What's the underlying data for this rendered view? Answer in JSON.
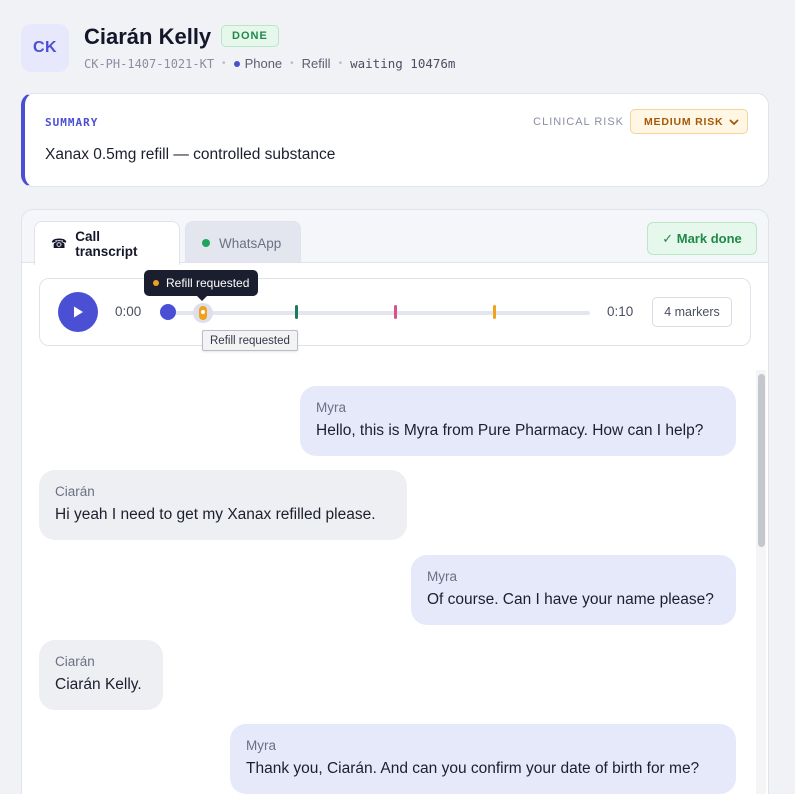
{
  "contact": {
    "initials": "CK",
    "name": "Ciarán Kelly",
    "status": "DONE",
    "id": "CK-PH-1407-1021-KT",
    "channel": "Phone",
    "type": "Refill",
    "waiting": "waiting 10476m"
  },
  "summary": {
    "label": "SUMMARY",
    "text": "Xanax 0.5mg refill — controlled substance",
    "risk_label": "CLINICAL RISK",
    "risk_value": "MEDIUM RISK"
  },
  "tabs": [
    {
      "label": "Call transcript",
      "icon": "phone-icon",
      "active": true
    },
    {
      "label": "WhatsApp",
      "icon": "status-dot",
      "active": false
    }
  ],
  "actions": {
    "mark_done": "✓ Mark done"
  },
  "player": {
    "time_start": "0:00",
    "time_end": "0:10",
    "markers_button": "4 markers",
    "progress": 0,
    "markers": [
      {
        "color": "#f0a21b",
        "label": "Refill requested",
        "active": true
      },
      {
        "color": "#1f7a5a"
      },
      {
        "color": "#d9538a"
      },
      {
        "color": "#f0a21b"
      }
    ],
    "tooltip": "Refill requested",
    "native_tooltip": "Refill requested"
  },
  "messages": [
    {
      "speaker": "Myra",
      "text": "Hello, this is Myra from Pure Pharmacy. How can I help?",
      "side": "staff"
    },
    {
      "speaker": "Ciarán",
      "text": "Hi yeah I need to get my Xanax refilled please.",
      "side": "patient"
    },
    {
      "speaker": "Myra",
      "text": "Of course. Can I have your name please?",
      "side": "staff"
    },
    {
      "speaker": "Ciarán",
      "text": "Ciarán Kelly.",
      "side": "patient"
    },
    {
      "speaker": "Myra",
      "text": "Thank you, Ciarán. And can you confirm your date of birth for me?",
      "side": "staff"
    }
  ],
  "colors": {
    "accent": "#4b4fd4",
    "done_green": "#1f8a48",
    "risk_amber": "#a4580a",
    "staff_bubble": "#e6e9fa",
    "patient_bubble": "#eeeff3"
  }
}
